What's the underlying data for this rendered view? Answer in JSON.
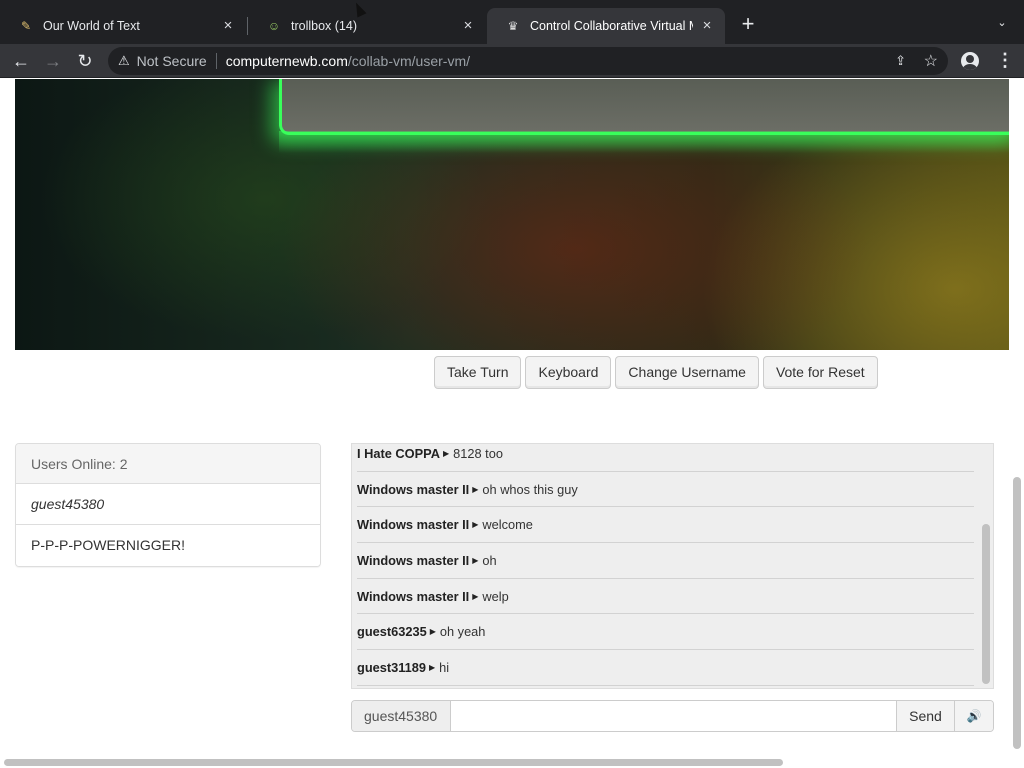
{
  "browser": {
    "tabs": [
      {
        "title": "Our World of Text",
        "favicon": "owot-favicon",
        "close": "×"
      },
      {
        "title": "trollbox (14)",
        "favicon": "trollbox-favicon",
        "close": "×"
      },
      {
        "title": "Control Collaborative Virtual M",
        "favicon": "collabvm-favicon",
        "close": "×",
        "active": true
      }
    ],
    "new_tab": "+",
    "tab_search": "⌄",
    "back": "←",
    "forward": "→",
    "reload": "↻",
    "security_icon": "⚠",
    "security_label": "Not Secure",
    "url_host": "computernewb.com",
    "url_path": "/collab-vm/user-vm/",
    "share": "⇪",
    "star": "☆",
    "menu": "⋮"
  },
  "vm_controls": {
    "take_turn": "Take Turn",
    "keyboard": "Keyboard",
    "change_username": "Change Username",
    "vote_reset": "Vote for Reset"
  },
  "users_panel": {
    "header": "Users Online: 2",
    "users": [
      "guest45380",
      "P-P-P-POWERNIGGER!"
    ]
  },
  "chat": {
    "messages": [
      {
        "user": "I Hate COPPA",
        "text": "8128 too"
      },
      {
        "user": "Windows master II",
        "text": "oh whos this guy"
      },
      {
        "user": "Windows master II",
        "text": "welcome"
      },
      {
        "user": "Windows master II",
        "text": "oh"
      },
      {
        "user": "Windows master II",
        "text": "welp"
      },
      {
        "user": "guest63235",
        "text": "oh yeah"
      },
      {
        "user": "guest31189",
        "text": "hi"
      }
    ],
    "arrow": "▶",
    "username_addon": "guest45380",
    "input_value": "",
    "send": "Send",
    "volume": "🔊"
  }
}
